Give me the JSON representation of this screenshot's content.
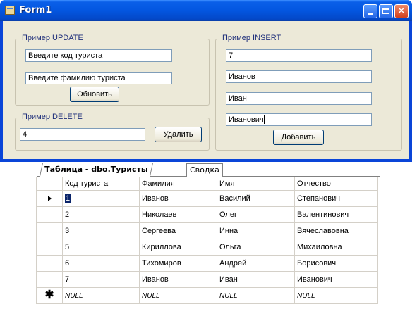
{
  "window": {
    "title": "Form1",
    "title_icon": "form-icon",
    "controls": [
      "minimize-icon",
      "maximize-icon",
      "close-icon"
    ],
    "close_glyph": "✕"
  },
  "update_group": {
    "label": "Пример UPDATE",
    "code_field": "Введите код туриста",
    "surname_field": "Введите фамилию туриста",
    "button": "Обновить"
  },
  "delete_group": {
    "label": "Пример DELETE",
    "value": "4",
    "button": "Удалить"
  },
  "insert_group": {
    "label": "Пример INSERT",
    "code_value": "7",
    "surname_value": "Иванов",
    "name_value": "Иван",
    "patronymic_value": "Иванович",
    "button": "Добавить"
  },
  "tabs": {
    "active": "Таблица - dbo.Туристы",
    "inactive": "Сводка"
  },
  "grid": {
    "columns": [
      "Код туриста",
      "Фамилия",
      "Имя",
      "Отчество"
    ],
    "rows": [
      [
        "1",
        "Иванов",
        "Василий",
        "Степанович"
      ],
      [
        "2",
        "Николаев",
        "Олег",
        "Валентинович"
      ],
      [
        "3",
        "Сергеева",
        "Инна",
        "Вячеславовна"
      ],
      [
        "5",
        "Кириллова",
        "Ольга",
        "Михаиловна"
      ],
      [
        "6",
        "Тихомиров",
        "Андрей",
        "Борисович"
      ],
      [
        "7",
        "Иванов",
        "Иван",
        "Иванович"
      ]
    ],
    "new_row": [
      "NULL",
      "NULL",
      "NULL",
      "NULL"
    ],
    "current_row_marker": "current-row-arrow-icon",
    "new_row_marker": "new-row-star-icon",
    "new_row_glyph": "✱"
  },
  "colors": {
    "titlebar": "#0356e0",
    "client_bg": "#ece9d8",
    "group_label": "#1e2e7a",
    "selection": "#0a246a"
  }
}
